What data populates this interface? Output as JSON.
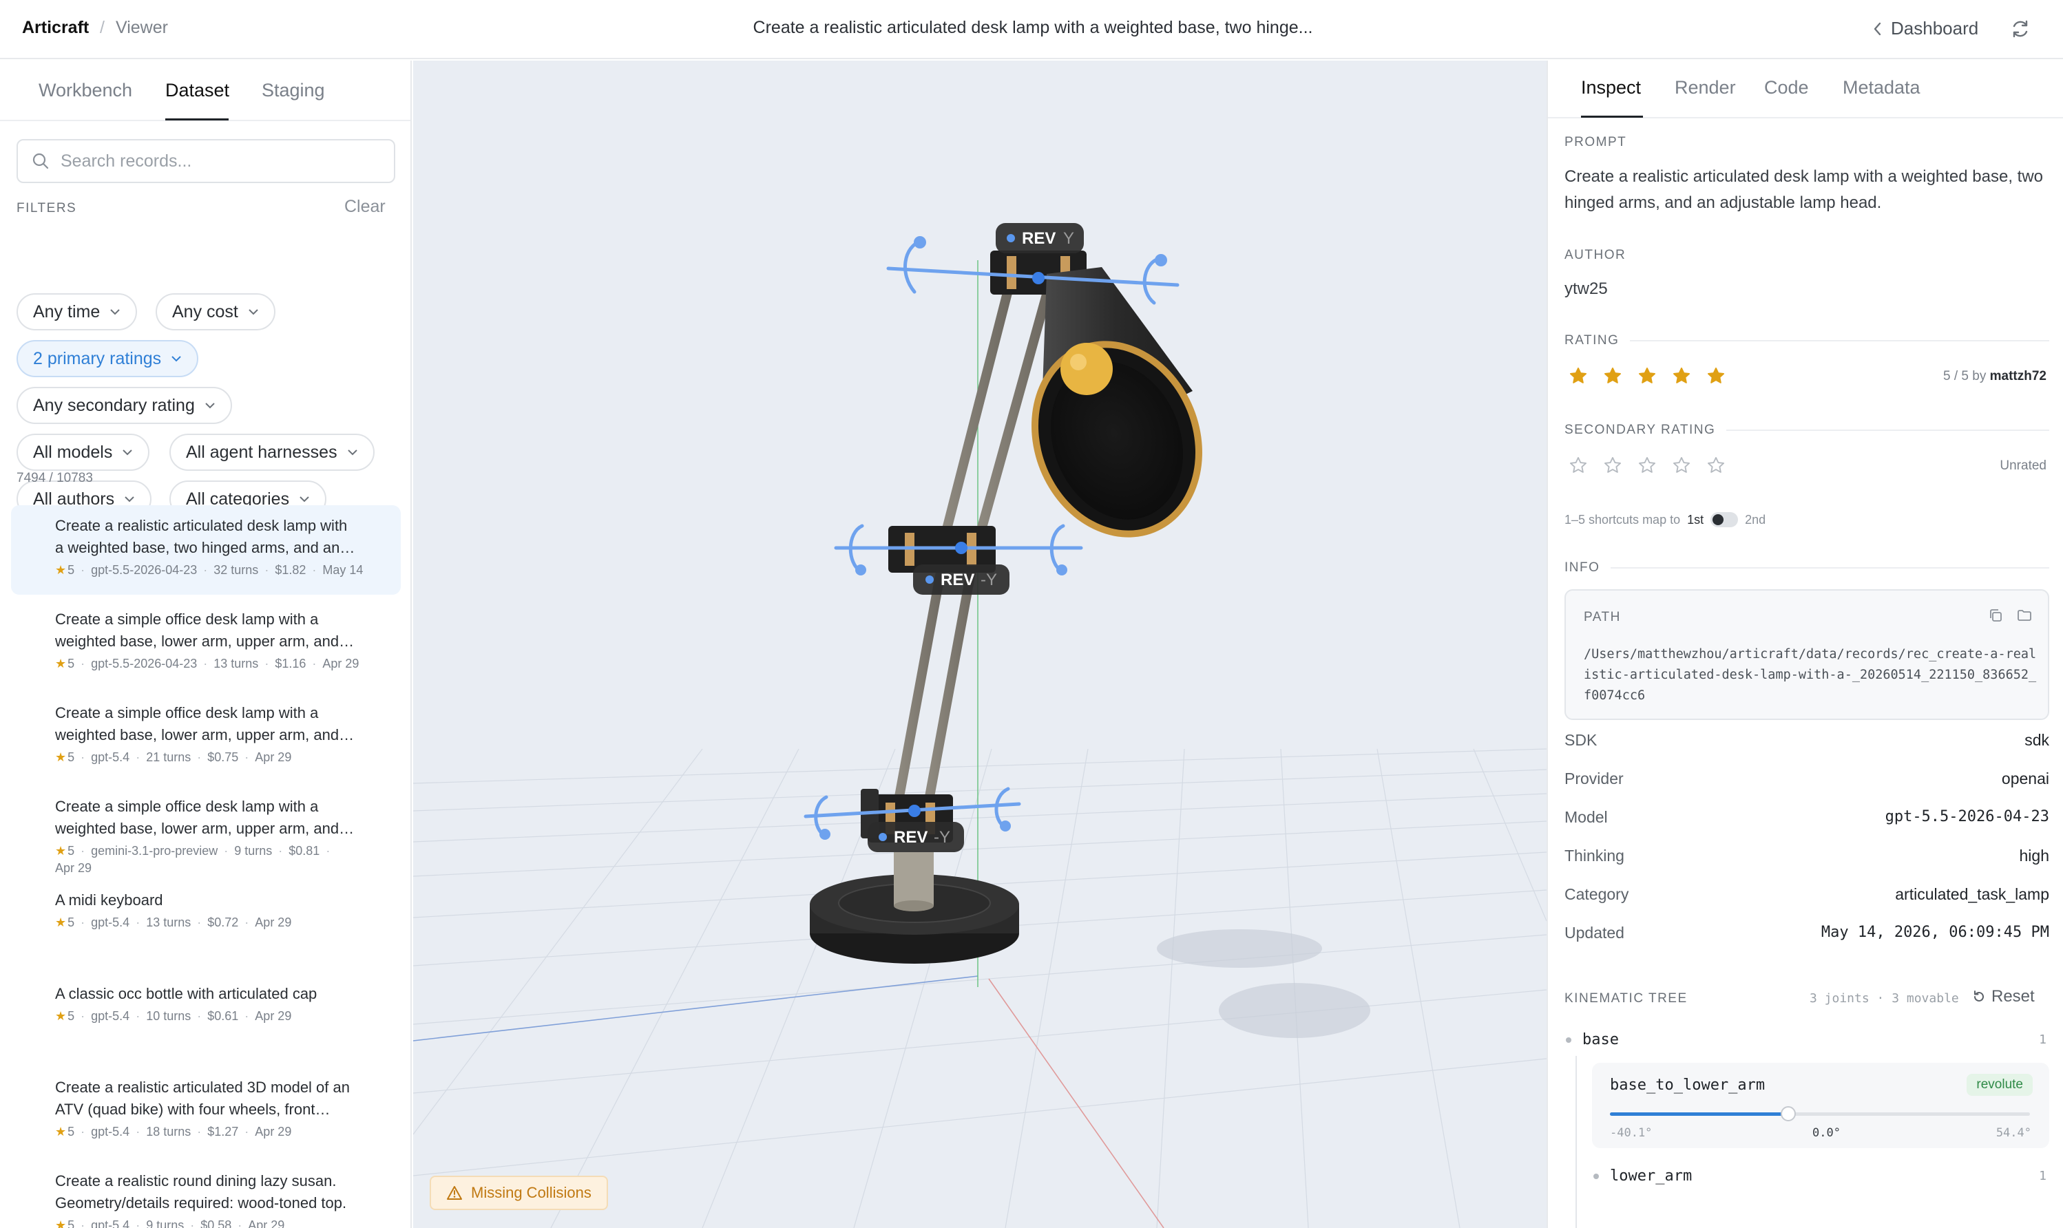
{
  "header": {
    "brand": "Articraft",
    "crumb_sep": "/",
    "crumb": "Viewer",
    "title": "Create a realistic articulated desk lamp with a weighted base, two hinge...",
    "dashboard_label": "Dashboard",
    "back_icon": "chevron-left-icon",
    "refresh_icon": "refresh-icon"
  },
  "left": {
    "tabs": [
      {
        "label": "Workbench",
        "active": false
      },
      {
        "label": "Dataset",
        "active": true
      },
      {
        "label": "Staging",
        "active": false
      }
    ],
    "search_placeholder": "Search records...",
    "filters_label": "FILTERS",
    "clear_label": "Clear",
    "chips": [
      {
        "label": "Any time"
      },
      {
        "label": "Any cost"
      },
      {
        "label": "2 primary ratings",
        "active": true
      },
      {
        "label": "Any secondary rating"
      },
      {
        "label": "All models"
      },
      {
        "label": "All agent harnesses"
      },
      {
        "label": "All authors"
      },
      {
        "label": "All categories"
      }
    ],
    "count": "7494 / 10783",
    "records": [
      {
        "title": "Create a realistic articulated desk lamp with a weighted base, two hinged arms, and an adjustable lamp head.",
        "rating": "5",
        "model": "gpt-5.5-2026-04-23",
        "turns": "32 turns",
        "cost": "$1.82",
        "date": "May 14"
      },
      {
        "title": "Create a simple office desk lamp with a weighted base, lower arm, upper arm, and shade.",
        "rating": "5",
        "model": "gpt-5.5-2026-04-23",
        "turns": "13 turns",
        "cost": "$1.16",
        "date": "Apr 29"
      },
      {
        "title": "Create a simple office desk lamp with a weighted base, lower arm, upper arm, and shade.",
        "rating": "5",
        "model": "gpt-5.4",
        "turns": "21 turns",
        "cost": "$0.75",
        "date": "Apr 29"
      },
      {
        "title": "Create a simple office desk lamp with a weighted base, lower arm, upper arm, and shade.",
        "rating": "5",
        "model": "gemini-3.1-pro-preview",
        "turns": "9 turns",
        "cost": "$0.81",
        "date": "Apr 29"
      },
      {
        "title": "A midi keyboard",
        "rating": "5",
        "model": "gpt-5.4",
        "turns": "13 turns",
        "cost": "$0.72",
        "date": "Apr 29"
      },
      {
        "title": "A classic occ bottle with articulated cap",
        "rating": "5",
        "model": "gpt-5.4",
        "turns": "10 turns",
        "cost": "$0.61",
        "date": "Apr 29"
      },
      {
        "title": "Create a realistic articulated 3D model of an ATV (quad bike) with four wheels, front suspension.",
        "rating": "5",
        "model": "gpt-5.4",
        "turns": "18 turns",
        "cost": "$1.27",
        "date": "Apr 29"
      },
      {
        "title": "Create a realistic round dining lazy susan. Geometry/details required: wood-toned top.",
        "rating": "5",
        "model": "gpt-5.4",
        "turns": "9 turns",
        "cost": "$0.58",
        "date": "Apr 29"
      }
    ]
  },
  "viewport": {
    "joint_tags": [
      {
        "kind": "REV",
        "axis": "Y"
      },
      {
        "kind": "REV",
        "axis": "-Y"
      },
      {
        "kind": "REV",
        "axis": "-Y"
      }
    ],
    "warning": "Missing Collisions",
    "warning_icon": "warning-triangle-icon"
  },
  "right": {
    "tabs": [
      {
        "label": "Inspect",
        "active": true
      },
      {
        "label": "Render",
        "active": false
      },
      {
        "label": "Code",
        "active": false
      },
      {
        "label": "Metadata",
        "active": false
      }
    ],
    "prompt_label": "PROMPT",
    "prompt": "Create a realistic articulated desk lamp with a weighted base, two hinged arms, and an adjustable lamp head.",
    "author_label": "AUTHOR",
    "author": "ytw25",
    "rating_label": "RATING",
    "rating_value": 5,
    "rating_text": "5 / 5 by",
    "rating_user": "mattzh72",
    "secondary_label": "SECONDARY RATING",
    "secondary_value": 0,
    "secondary_text": "Unrated",
    "shortcut_text": "1–5 shortcuts map to",
    "shortcut_first": "1st",
    "shortcut_second": "2nd",
    "info_label": "INFO",
    "path_label": "PATH",
    "path": "/Users/matthewzhou/articraft/data/records/rec_create-a-realistic-articulated-desk-lamp-with-a-_20260514_221150_836652_f0074cc6",
    "info": [
      {
        "key": "SDK",
        "value": "sdk",
        "mono": false
      },
      {
        "key": "Provider",
        "value": "openai",
        "mono": false
      },
      {
        "key": "Model",
        "value": "gpt-5.5-2026-04-23",
        "mono": true
      },
      {
        "key": "Thinking",
        "value": "high",
        "mono": false
      },
      {
        "key": "Category",
        "value": "articulated_task_lamp",
        "mono": false
      },
      {
        "key": "Updated",
        "value": "May 14, 2026, 06:09:45 PM",
        "mono": true
      }
    ],
    "kinematic_label": "KINEMATIC TREE",
    "kinematic_meta": "3 joints · 3 movable",
    "reset_label": "Reset",
    "tree": {
      "root": "base",
      "root_count": "1",
      "joint": {
        "name": "base_to_lower_arm",
        "type": "revolute",
        "min": "-40.1°",
        "current": "0.0°",
        "max": "54.4°",
        "min_value": -40.1,
        "current_value": 0.0,
        "max_value": 54.4
      },
      "child": "lower_arm",
      "child_count": "1"
    }
  },
  "colors": {
    "accent": "#2f7fd6",
    "star": "#e0a014",
    "warning": "#c07912",
    "badge_green": "#2f8a47"
  }
}
